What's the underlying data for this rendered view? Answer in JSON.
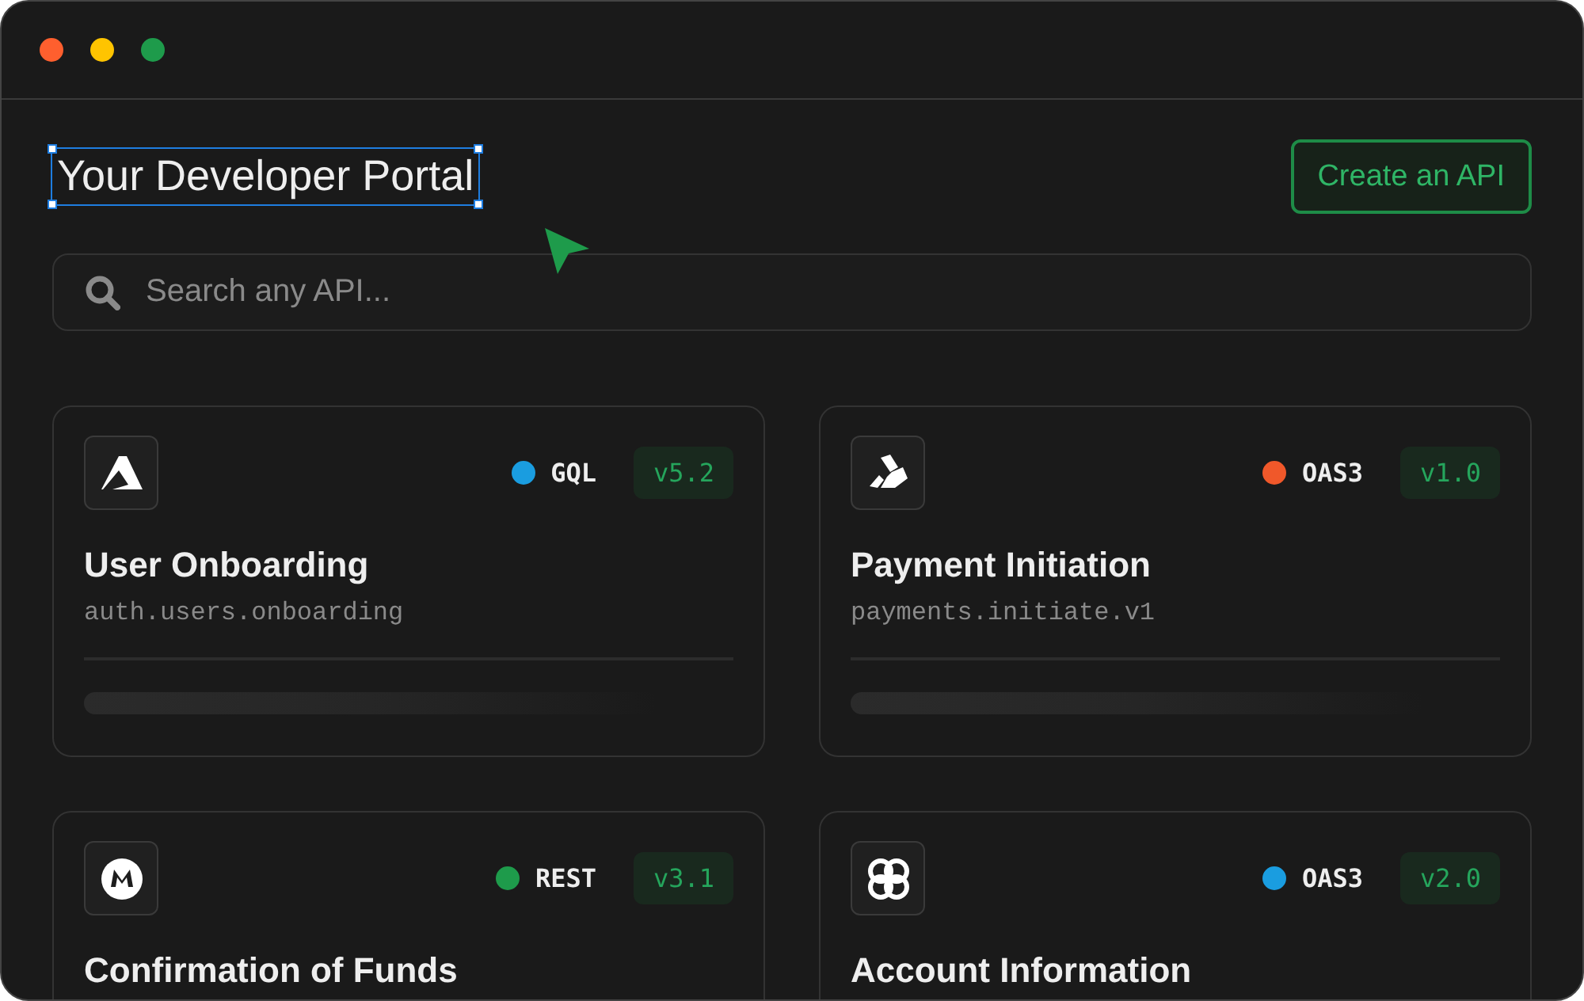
{
  "window": {
    "controls": [
      {
        "color": "#ff5f2e"
      },
      {
        "color": "#ffc400"
      },
      {
        "color": "#1e9b4b"
      }
    ]
  },
  "header": {
    "title": "Your Developer Portal",
    "title_selected": true,
    "button": "Create an API"
  },
  "search": {
    "placeholder": "Search any API..."
  },
  "apis": [
    {
      "name": "User Onboarding",
      "path": "auth.users.onboarding",
      "spec": "GQL",
      "color": "#1a9de0",
      "version": "v5.2"
    },
    {
      "name": "Payment Initiation",
      "path": "payments.initiate.v1",
      "spec": "OAS3",
      "color": "#f0582a",
      "version": "v1.0"
    },
    {
      "name": "Confirmation of Funds",
      "spec": "REST",
      "color": "#1e9b4b",
      "version": "v3.1"
    },
    {
      "name": "Account Information",
      "spec": "OAS3",
      "color": "#1a9de0",
      "version": "v2.0"
    }
  ]
}
